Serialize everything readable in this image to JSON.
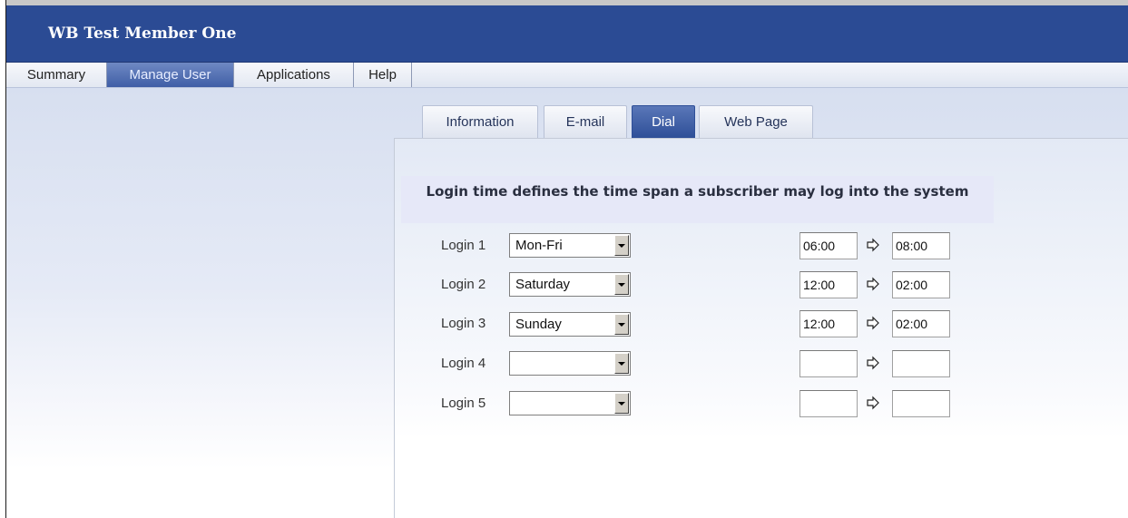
{
  "header": {
    "title": "WB Test Member One"
  },
  "nav": {
    "items": [
      {
        "label": "Summary"
      },
      {
        "label": "Manage User"
      },
      {
        "label": "Applications"
      },
      {
        "label": "Help"
      }
    ],
    "active": "Manage User"
  },
  "tabs": {
    "items": [
      {
        "label": "Information"
      },
      {
        "label": "E-mail"
      },
      {
        "label": "Dial"
      },
      {
        "label": "Web Page"
      }
    ],
    "active": "Dial"
  },
  "login_panel": {
    "description": "Login time defines the time span a subscriber may log into the system",
    "rows": [
      {
        "label": "Login 1",
        "day": "Mon-Fri",
        "start": "06:00",
        "end": "08:00"
      },
      {
        "label": "Login 2",
        "day": "Saturday",
        "start": "12:00",
        "end": "02:00"
      },
      {
        "label": "Login 3",
        "day": "Sunday",
        "start": "12:00",
        "end": "02:00"
      },
      {
        "label": "Login 4",
        "day": "",
        "start": "",
        "end": ""
      },
      {
        "label": "Login 5",
        "day": "",
        "start": "",
        "end": ""
      }
    ],
    "arrow_icon": "right-arrow-icon"
  },
  "colors": {
    "header_bg": "#2b4b94",
    "active_tab": "#2e4f98",
    "info_box_bg": "#e6e8f8"
  }
}
